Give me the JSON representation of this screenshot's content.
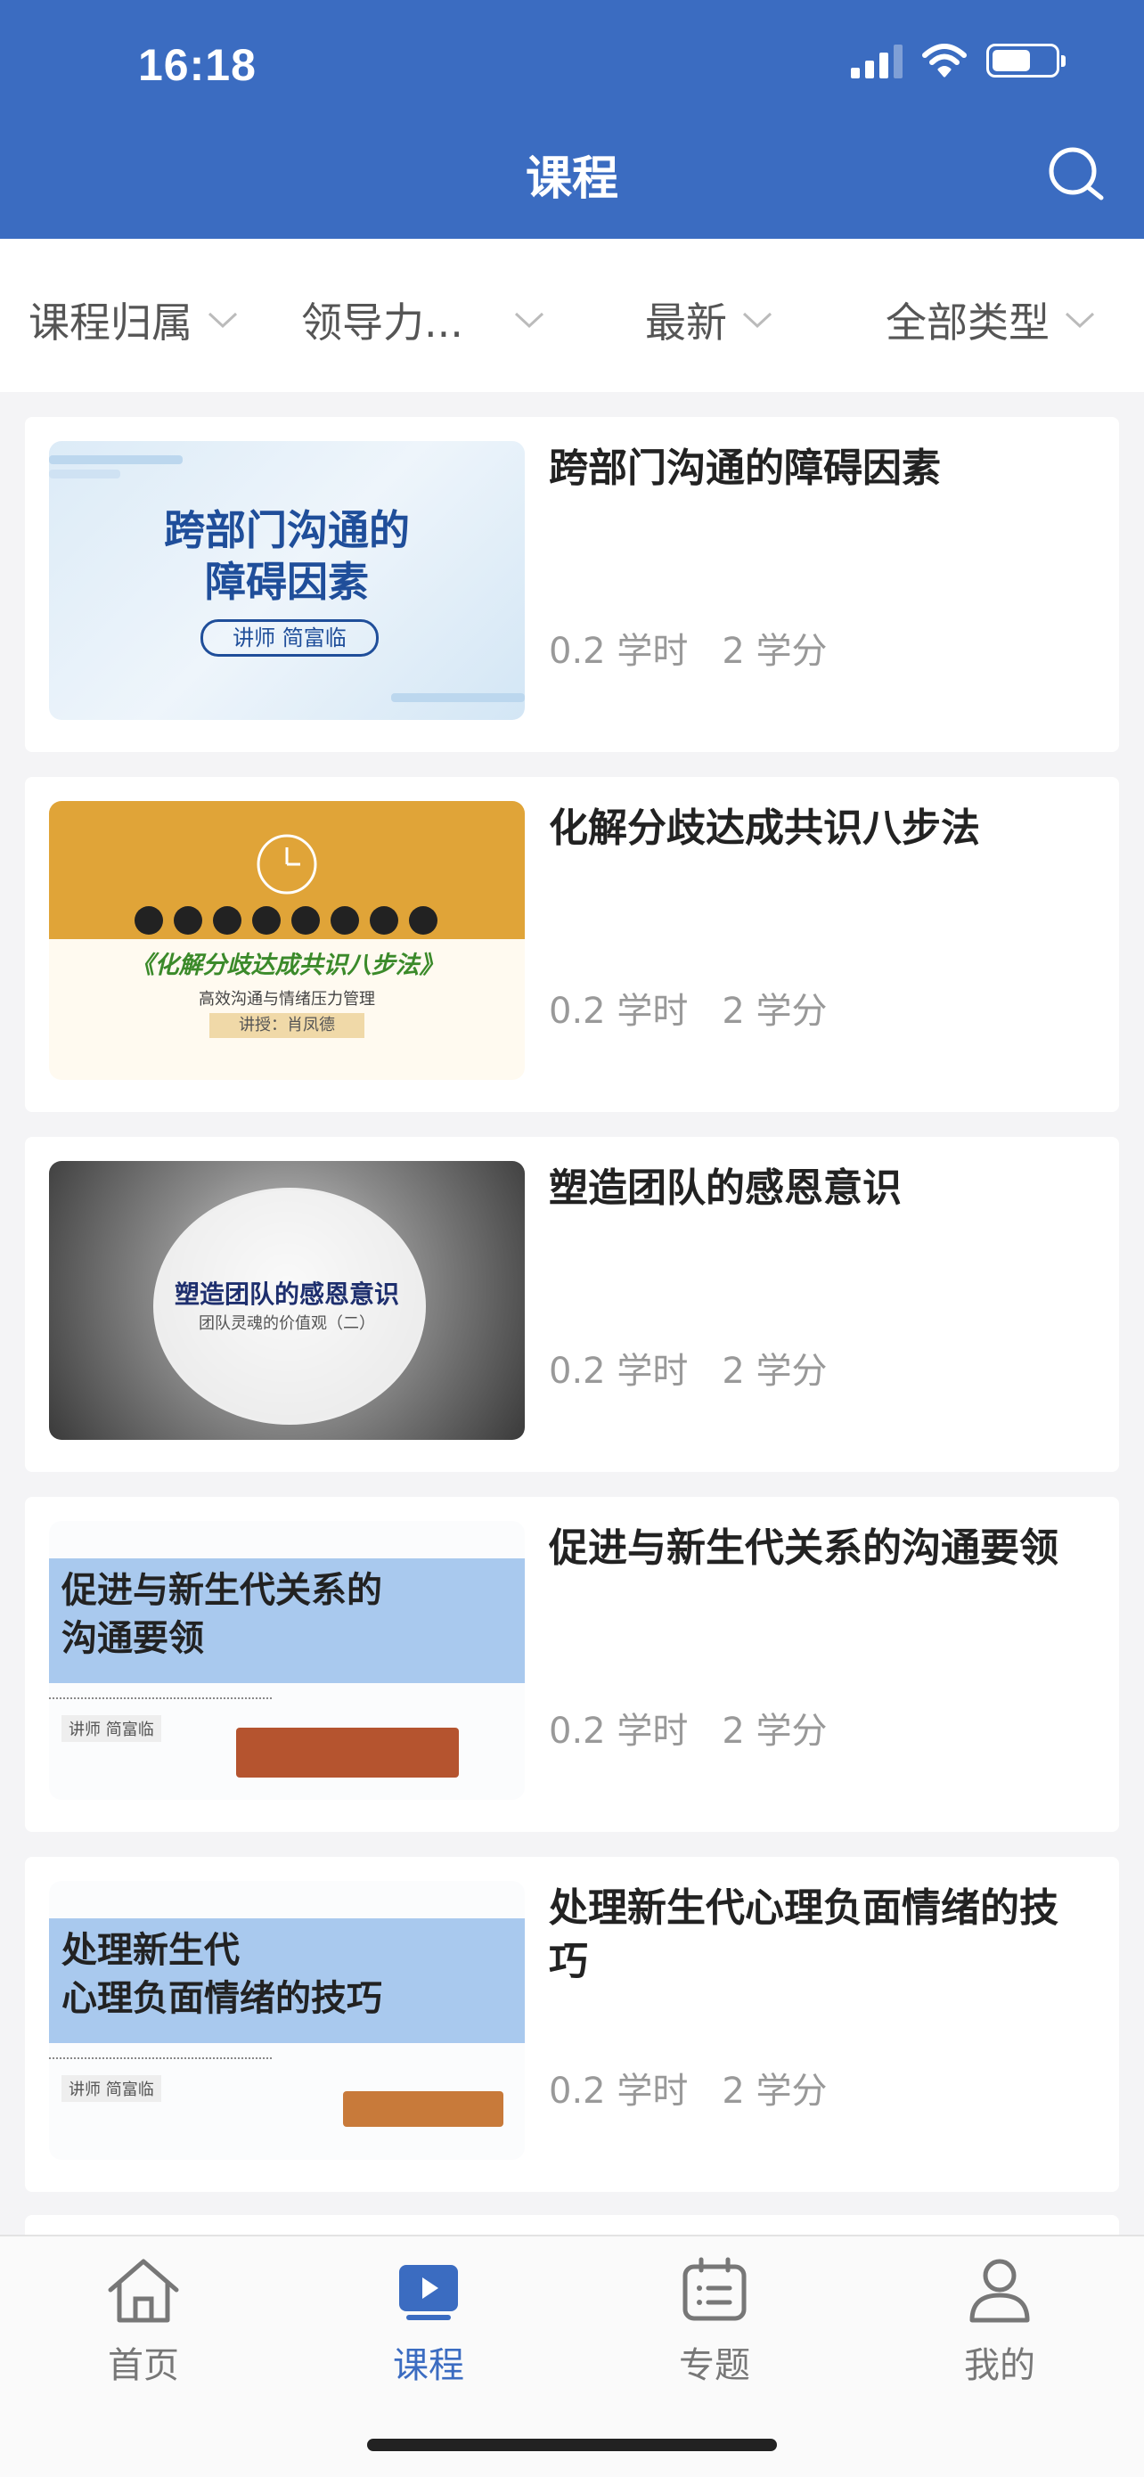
{
  "status_bar": {
    "time": "16:18"
  },
  "header": {
    "title": "课程"
  },
  "filters": [
    {
      "label": "课程归属"
    },
    {
      "label": "领导力..."
    },
    {
      "label": "最新"
    },
    {
      "label": "全部类型"
    }
  ],
  "courses": [
    {
      "title": "跨部门沟通的障碍因素",
      "hours": "0.2 学时",
      "credits": "2 学分",
      "thumb_line1": "跨部门沟通的",
      "thumb_line2": "障碍因素",
      "thumb_lecturer": "讲师 简富临"
    },
    {
      "title": "化解分歧达成共识八步法",
      "hours": "0.2 学时",
      "credits": "2 学分",
      "thumb_line1": "《化解分歧达成共识八步法》",
      "thumb_line2": "高效沟通与情绪压力管理",
      "thumb_lecturer": "讲授：肖凤德"
    },
    {
      "title": "塑造团队的感恩意识",
      "hours": "0.2 学时",
      "credits": "2 学分",
      "thumb_line1": "塑造团队的感恩意识",
      "thumb_line2": "团队灵魂的价值观（二）"
    },
    {
      "title": "促进与新生代关系的沟通要领",
      "hours": "0.2 学时",
      "credits": "2 学分",
      "thumb_line1": "促进与新生代关系的",
      "thumb_line2": "沟通要领",
      "thumb_lecturer": "讲师 简富临"
    },
    {
      "title": "处理新生代心理负面情绪的技巧",
      "hours": "0.2 学时",
      "credits": "2 学分",
      "thumb_line1": "处理新生代",
      "thumb_line2": "心理负面情绪的技巧",
      "thumb_lecturer": "讲师 简富临"
    }
  ],
  "tabbar": {
    "home": "首页",
    "courses": "课程",
    "topics": "专题",
    "mine": "我的"
  },
  "colors": {
    "brand": "#3b6cc1"
  }
}
